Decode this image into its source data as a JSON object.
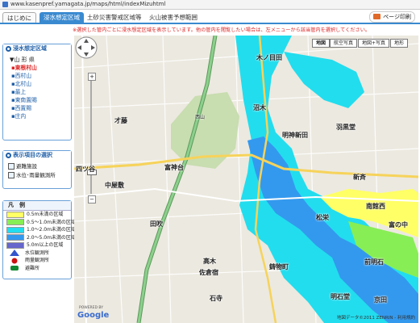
{
  "browser": {
    "url": "www.kasenpref.yamagata.jp/maps/html/indexMizuhtml"
  },
  "tabs": [
    {
      "label": "はじめに"
    },
    {
      "label": "浸水想定区域"
    },
    {
      "label": "土砂災害警戒区域等"
    },
    {
      "label": "火山被害予想範囲"
    }
  ],
  "header": {
    "print_label": "ページ印刷"
  },
  "notice": "※選択した管内ごとに浸水想定区域を表示しています。他の管内を閲覧したい場合は、左メニューから該当管内を選択してください。",
  "sidebar": {
    "area_title": "浸水想定区域",
    "prefecture": "▼山 形 県",
    "cities": [
      "▪東根村山",
      "▪西村山",
      "▪北村山",
      "▪最上",
      "▪東南置賜",
      "▪西置賜",
      "▪庄内"
    ],
    "selected_city": "▪東根村山",
    "display_title": "表示項目の選択",
    "checks": [
      "避難施設",
      "水位･雨量観測所"
    ],
    "legend_title": "凡　例",
    "legend": [
      {
        "label": "0.5m未満の区域",
        "color": "#ffff66"
      },
      {
        "label": "0.5〜1.0m未満の区域",
        "color": "#88ee55"
      },
      {
        "label": "1.0〜2.0m未満の区域",
        "color": "#22ddee"
      },
      {
        "label": "2.0〜5.0m未満の区域",
        "color": "#3399ee"
      },
      {
        "label": "5.0m以上の区域",
        "color": "#6666cc"
      }
    ],
    "legend_icons": [
      {
        "label": "水位観測所",
        "icon": "triangle",
        "color": "#3355cc"
      },
      {
        "label": "雨量観測所",
        "icon": "circle",
        "color": "#cc1111"
      },
      {
        "label": "避難所",
        "icon": "person",
        "color": "#118833"
      }
    ]
  },
  "map": {
    "types": [
      {
        "label": "地図",
        "active": true
      },
      {
        "label": "航空写真",
        "active": false
      },
      {
        "label": "地図+写真",
        "active": false
      },
      {
        "label": "地形",
        "active": false
      }
    ],
    "labels": {
      "kiguchi": "木ノ目田",
      "numaki": "沼木",
      "meijishinden": "明神新田",
      "hagurodo": "羽黒堂",
      "saitou": "才藤",
      "tomijindai": "富神台",
      "yotsuga": "四ツ谷",
      "nakayashiki": "中屋敷",
      "shinsai": "新斉",
      "matsuei": "松栄",
      "minamitate": "南館西",
      "tominaka": "富の中",
      "tabuki": "田吹",
      "takagi": "高木",
      "sakusa": "佐倉宿",
      "ikkamachi": "鋳物町",
      "maeakashi": "前明石",
      "akashinaka": "明石堂",
      "ishizaki": "石寺",
      "kyoden": "京田",
      "nishiyama": "西山"
    },
    "powered": "POWERED BY",
    "google": "Google",
    "copyright": "地図データ©2011 ZENRIN - 利用規約"
  }
}
